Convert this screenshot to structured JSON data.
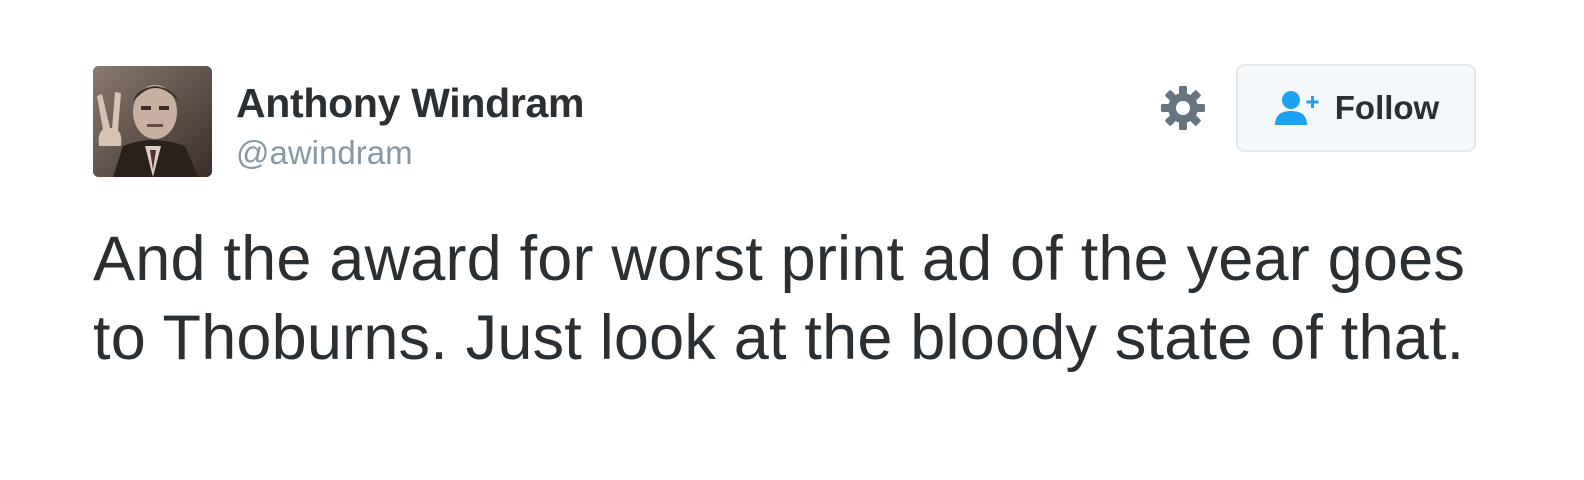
{
  "author": {
    "name": "Anthony Windram",
    "handle": "@awindram",
    "avatar_icon": "profile-photo"
  },
  "actions": {
    "settings_icon": "gear-icon",
    "follow_label": "Follow",
    "follow_icon": "add-user-icon"
  },
  "tweet": {
    "text": "And the award for worst print ad of the year goes to Thoburns. Just look at the bloody state of that."
  },
  "colors": {
    "text": "#292f33",
    "muted": "#8899a6",
    "accent": "#1da1f2",
    "button_bg": "#f5f8fa",
    "button_border": "#e1e8ed",
    "gear": "#66757f"
  }
}
